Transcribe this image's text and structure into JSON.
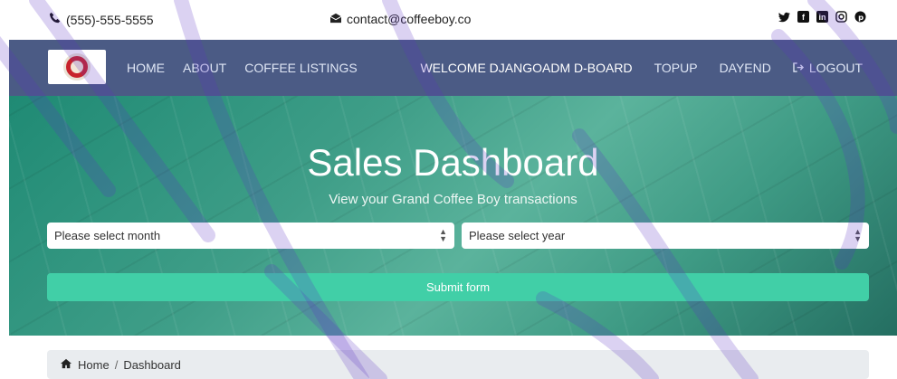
{
  "topbar": {
    "phone": "(555)-555-5555",
    "email": "contact@coffeeboy.co",
    "social_icons": [
      "twitter-icon",
      "facebook-icon",
      "linkedin-icon",
      "instagram-icon",
      "pinterest-icon"
    ]
  },
  "navbar": {
    "links_left": [
      "HOME",
      "ABOUT",
      "COFFEE LISTINGS"
    ],
    "links_right": [
      "WELCOME DJANGOADM D-BOARD",
      "TOPUP",
      "DAYEND",
      "LOGOUT"
    ]
  },
  "hero": {
    "title": "Sales Dashboard",
    "subtitle": "View your Grand Coffee Boy transactions",
    "month_placeholder": "Please select month",
    "year_placeholder": "Please select year",
    "submit_label": "Submit form"
  },
  "breadcrumb": {
    "home": "Home",
    "current": "Dashboard",
    "separator": "/"
  },
  "colors": {
    "navbar_bg": "#4b5b85",
    "submit_bg": "#41cfa7",
    "hero_accent": "#3f9e88"
  }
}
